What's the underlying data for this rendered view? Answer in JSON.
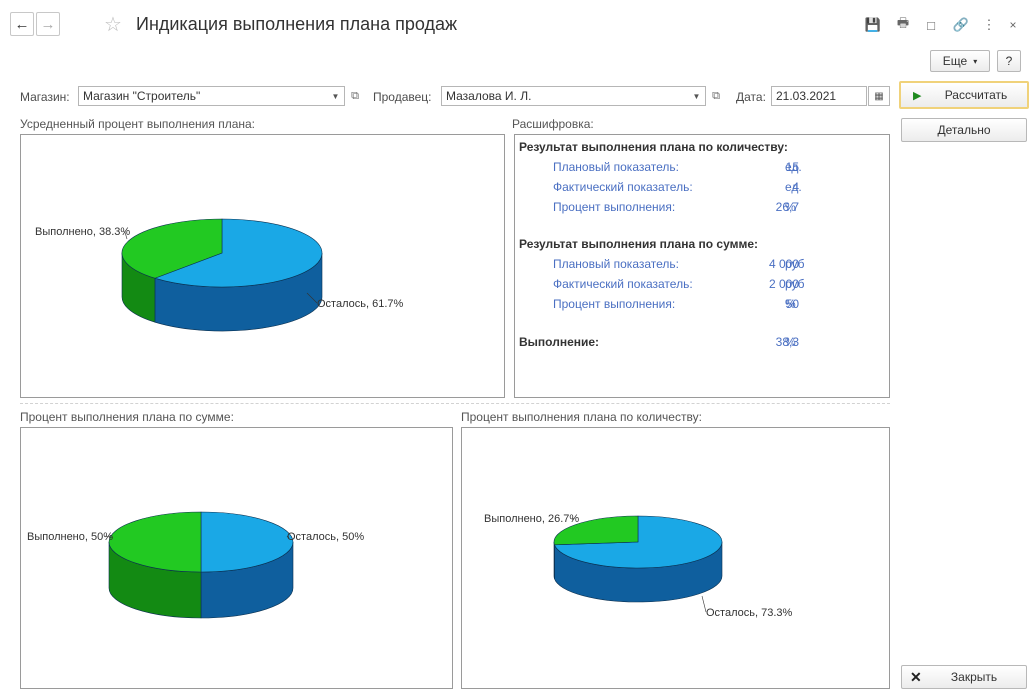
{
  "window": {
    "title": "Индикация выполнения плана продаж",
    "more_label": "Еще",
    "help_label": "?"
  },
  "form": {
    "shop_label": "Магазин:",
    "shop_value": "Магазин \"Строитель\"",
    "seller_label": "Продавец:",
    "seller_value": "Мазалова И. Л.",
    "date_label": "Дата:",
    "date_value": "21.03.2021"
  },
  "actions": {
    "calculate_label": "Рассчитать",
    "details_label": "Детально",
    "close_label": "Закрыть"
  },
  "panels": {
    "avg_label": "Усредненный процент выполнения плана:",
    "decode_label": "Расшифровка:",
    "sum_label": "Процент выполнения плана по сумме:",
    "qty_label": "Процент выполнения плана по количеству:"
  },
  "decode": {
    "qty_head": "Результат выполнения плана по количеству:",
    "qty_rows": [
      {
        "label": "Плановый показатель:",
        "value": "15",
        "unit": "ед."
      },
      {
        "label": "Фактический показатель:",
        "value": "4",
        "unit": "ед."
      },
      {
        "label": "Процент выполнения:",
        "value": "26,7",
        "unit": "%"
      }
    ],
    "sum_head": "Результат выполнения плана по сумме:",
    "sum_rows": [
      {
        "label": "Плановый показатель:",
        "value": "4 000",
        "unit": "руб"
      },
      {
        "label": "Фактический показатель:",
        "value": "2 000",
        "unit": "руб"
      },
      {
        "label": "Процент выполнения:",
        "value": "50",
        "unit": "%"
      }
    ],
    "total_head": "Выполнение:",
    "total_value": "38,3",
    "total_unit": "%"
  },
  "chart_data": [
    {
      "type": "pie",
      "slices": [
        {
          "label": "Выполнено, 38.3%",
          "value": 38.3,
          "color": "#22c922"
        },
        {
          "label": "Осталось, 61.7%",
          "value": 61.7,
          "color": "#1aa8e6"
        }
      ]
    },
    {
      "type": "pie",
      "slices": [
        {
          "label": "Выполнено, 50%",
          "value": 50,
          "color": "#22c922"
        },
        {
          "label": "Осталось, 50%",
          "value": 50,
          "color": "#1aa8e6"
        }
      ]
    },
    {
      "type": "pie",
      "slices": [
        {
          "label": "Выполнено, 26.7%",
          "value": 26.7,
          "color": "#22c922"
        },
        {
          "label": "Осталось, 73.3%",
          "value": 73.3,
          "color": "#1aa8e6"
        }
      ]
    }
  ],
  "colors": {
    "done_top": "#22c922",
    "done_side": "#138a13",
    "rest_top": "#1aa8e6",
    "rest_side": "#0f5f9e",
    "accent_play": "#1e8a1e"
  }
}
